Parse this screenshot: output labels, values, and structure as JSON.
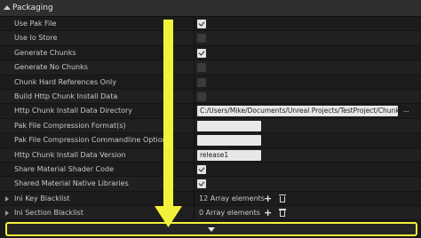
{
  "section": {
    "title": "Packaging"
  },
  "rows": [
    {
      "label": "Use Pak File",
      "kind": "checkbox",
      "checked": true
    },
    {
      "label": "Use Io Store",
      "kind": "checkbox",
      "checked": false
    },
    {
      "label": "Generate Chunks",
      "kind": "checkbox",
      "checked": true
    },
    {
      "label": "Generate No Chunks",
      "kind": "checkbox",
      "checked": false
    },
    {
      "label": "Chunk Hard References Only",
      "kind": "checkbox",
      "checked": false
    },
    {
      "label": "Build Http Chunk Install Data",
      "kind": "checkbox",
      "checked": false
    },
    {
      "label": "Http Chunk Install Data Directory",
      "kind": "path",
      "value": "C:/Users/Mike/Documents/Unreal Projects/TestProject/ChunkIn",
      "button": "..."
    },
    {
      "label": "Pak File Compression Format(s)",
      "kind": "text",
      "value": ""
    },
    {
      "label": "Pak File Compression Commandline Options",
      "kind": "text",
      "value": ""
    },
    {
      "label": "Http Chunk Install Data Version",
      "kind": "text",
      "value": "release1"
    },
    {
      "label": "Share Material Shader Code",
      "kind": "checkbox",
      "checked": true
    },
    {
      "label": "Shared Material Native Libraries",
      "kind": "checkbox",
      "checked": true
    },
    {
      "label": "Ini Key Blacklist",
      "kind": "array",
      "count": "12 Array elements",
      "add": "+"
    },
    {
      "label": "Ini Section Blacklist",
      "kind": "array",
      "count": "0 Array elements",
      "add": "+"
    }
  ],
  "colors": {
    "annotation": "#f2f23a"
  },
  "icons": {
    "collapse": "triangle-down-icon",
    "expander": "triangle-right-icon",
    "trash": "trash-icon",
    "scroll": "chevron-down-icon"
  }
}
